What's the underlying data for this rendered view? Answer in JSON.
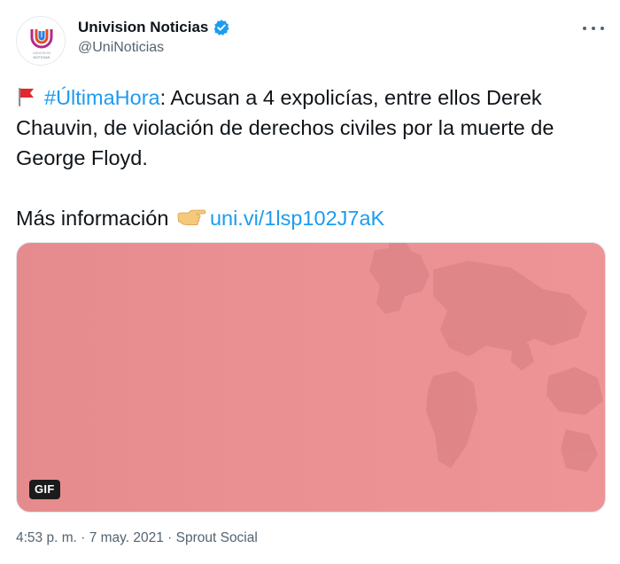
{
  "tweet": {
    "author": {
      "display_name": "Univision Noticias",
      "handle": "@UniNoticias",
      "verified": true,
      "avatar_text_line1": "UNIVISION NOTICIAS",
      "avatar_text_line2": "NOTICIAS",
      "icons": {
        "verified": "verified-badge-icon",
        "avatar": "univision-logo-icon"
      }
    },
    "more_menu_icon": "more-options-icon",
    "body": {
      "flag_emoji_icon": "red-flag-icon",
      "hashtag": "#ÚltimaHora",
      "line1_rest": ": Acusan a 4 expolicías, entre ellos Derek Chauvin, de violación de derechos civiles por la muerte de George Floyd.",
      "more_info_label": "Más información",
      "pointing_emoji_icon": "pointing-hand-icon",
      "link_text": "uni.vi/1lsp102J7aK"
    },
    "media": {
      "badge": "GIF"
    },
    "meta": {
      "timestamp": "4:53 p. m. · 7 may. 2021 · Sprout Social"
    },
    "colors": {
      "link": "#1d9bf0",
      "text": "#0f1419",
      "secondary": "#536471",
      "media_pink": "#ea9092"
    }
  }
}
